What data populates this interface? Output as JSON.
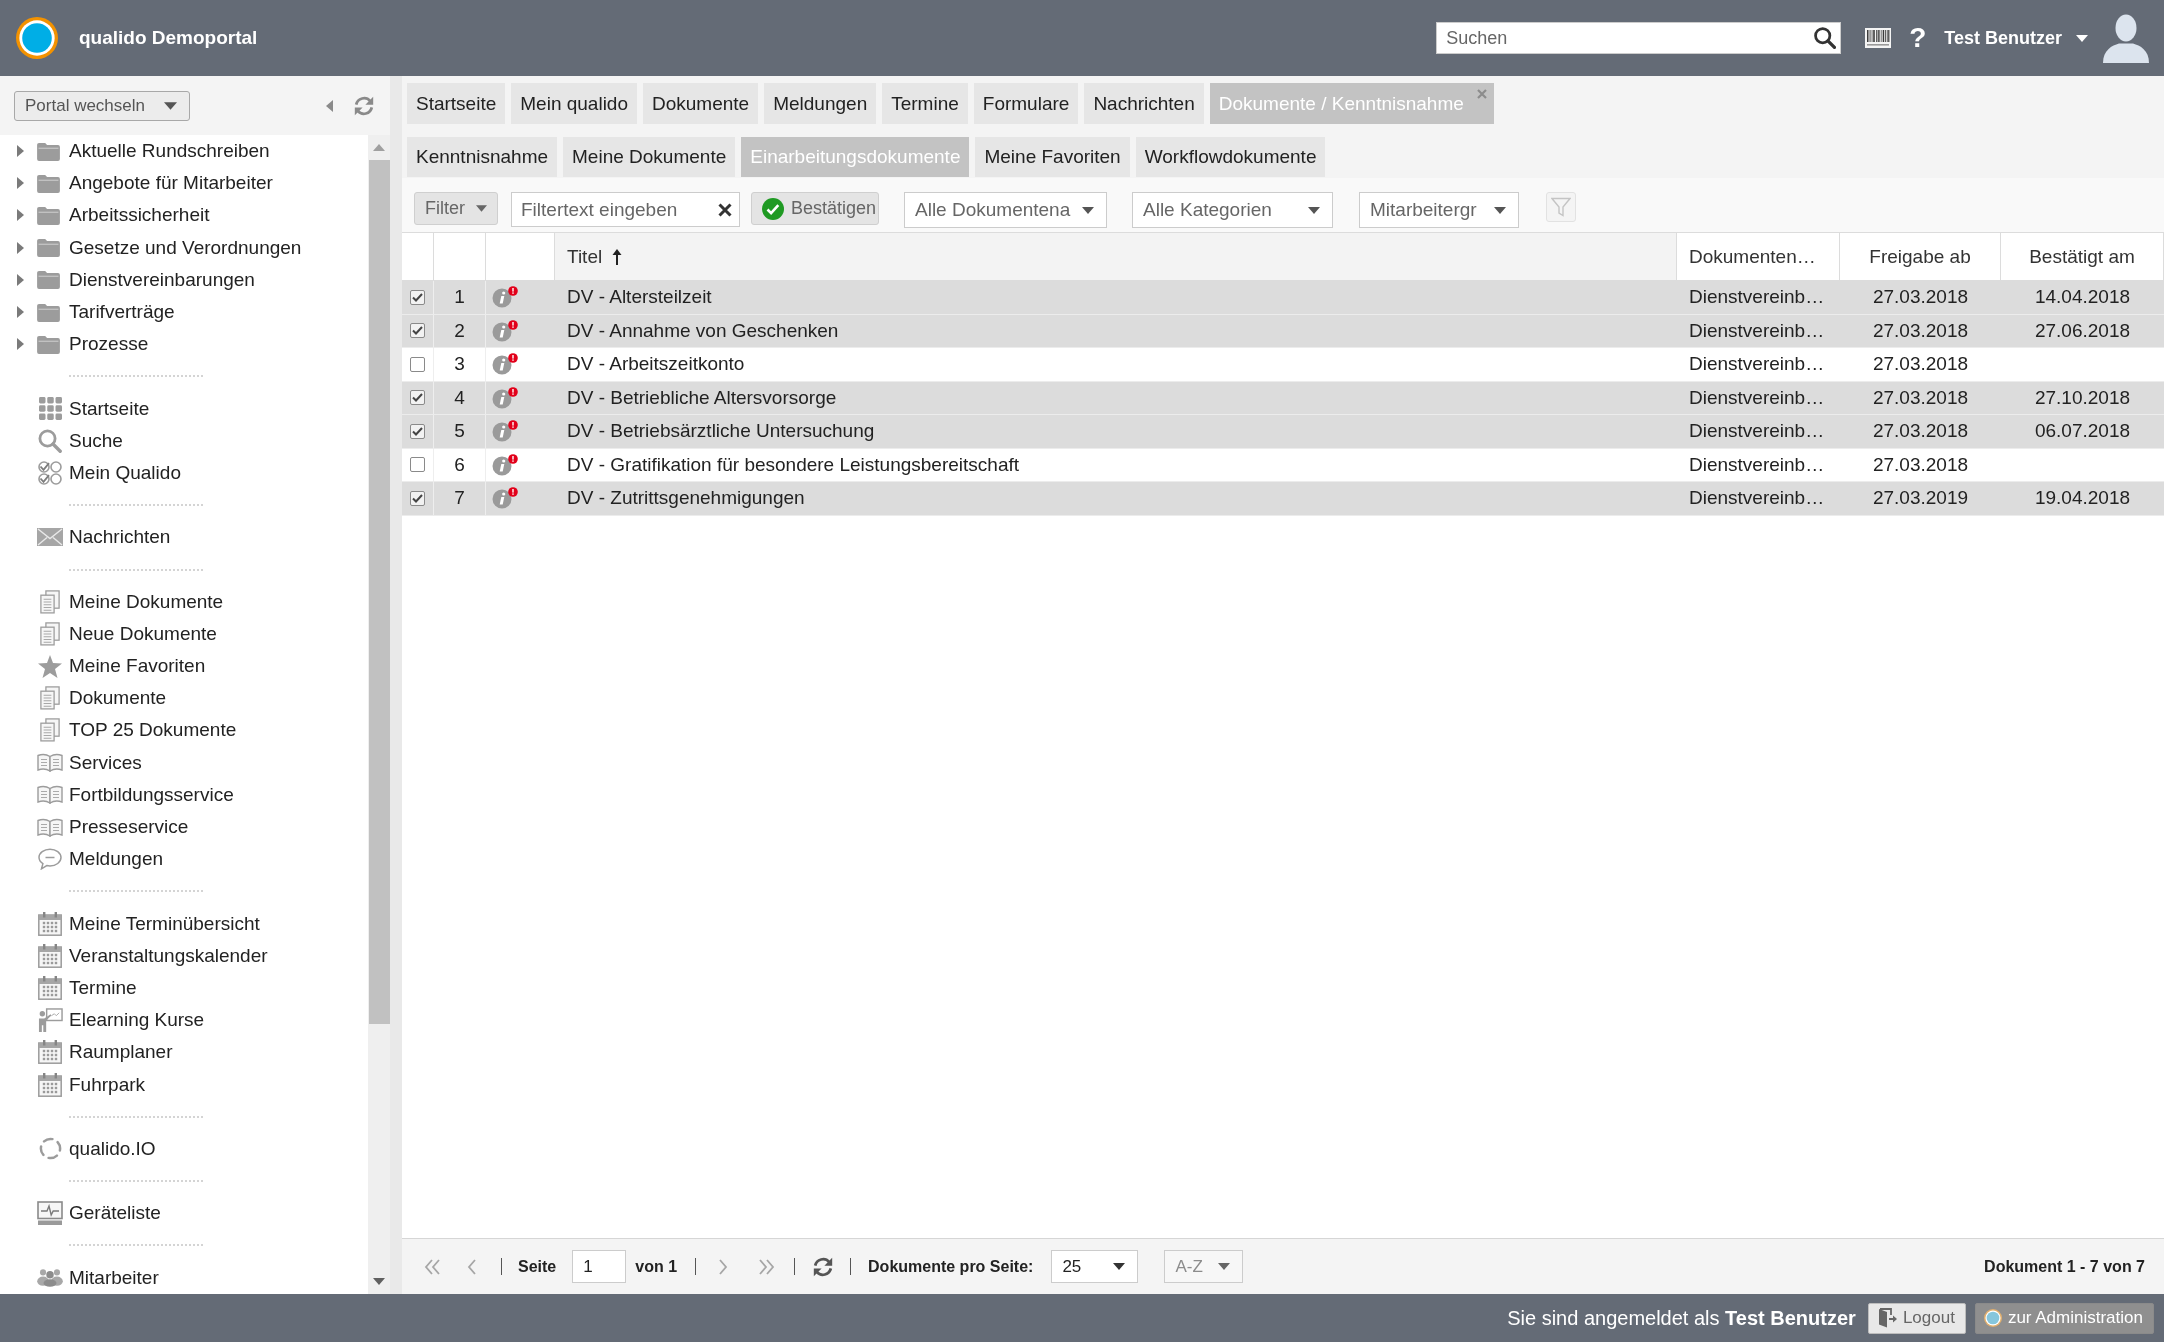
{
  "header": {
    "title": "qualido Demoportal",
    "search": {
      "placeholder": "Suchen"
    },
    "help": "?",
    "user": "Test Benutzer"
  },
  "sidebar": {
    "portal_switch": "Portal wechseln",
    "folders": [
      {
        "label": "Aktuelle Rundschreiben",
        "expanded": false
      },
      {
        "label": "Angebote für Mitarbeiter",
        "expanded": false
      },
      {
        "label": "Arbeitssicherheit",
        "expanded": false
      },
      {
        "label": "Gesetze und Verordnungen",
        "expanded": false
      },
      {
        "label": "Dienstvereinbarungen",
        "expanded": false
      },
      {
        "label": "Tarifverträge",
        "expanded": false
      },
      {
        "label": "Prozesse",
        "expanded": false
      }
    ],
    "groups": [
      {
        "items": [
          {
            "label": "Startseite",
            "kind": "tiles"
          },
          {
            "label": "Suche",
            "kind": "search"
          },
          {
            "label": "Mein Qualido",
            "kind": "checks"
          }
        ]
      },
      {
        "items": [
          {
            "label": "Nachrichten",
            "kind": "mail"
          }
        ]
      },
      {
        "items": [
          {
            "label": "Meine Dokumente",
            "kind": "pages"
          },
          {
            "label": "Neue Dokumente",
            "kind": "pages"
          },
          {
            "label": "Meine Favoriten",
            "kind": "star"
          },
          {
            "label": "Dokumente",
            "kind": "pages"
          },
          {
            "label": "TOP 25 Dokumente",
            "kind": "pages"
          },
          {
            "label": "Services",
            "kind": "book"
          },
          {
            "label": "Fortbildungsservice",
            "kind": "book"
          },
          {
            "label": "Presseservice",
            "kind": "book"
          },
          {
            "label": "Meldungen",
            "kind": "chat"
          }
        ]
      },
      {
        "items": [
          {
            "label": "Meine Terminübersicht",
            "kind": "calendar"
          },
          {
            "label": "Veranstaltungskalender",
            "kind": "calendar"
          },
          {
            "label": "Termine",
            "kind": "calendar"
          },
          {
            "label": "Elearning Kurse",
            "kind": "teacher"
          },
          {
            "label": "Raumplaner",
            "kind": "calendar"
          },
          {
            "label": "Fuhrpark",
            "kind": "calendar"
          }
        ]
      },
      {
        "items": [
          {
            "label": "qualido.IO",
            "kind": "cycle"
          }
        ]
      },
      {
        "items": [
          {
            "label": "Geräteliste",
            "kind": "monitor"
          }
        ]
      },
      {
        "items": [
          {
            "label": "Mitarbeiter",
            "kind": "people"
          }
        ]
      }
    ]
  },
  "tabs": [
    {
      "label": "Startseite",
      "selected": false,
      "closable": false
    },
    {
      "label": "Mein qualido",
      "selected": false,
      "closable": false
    },
    {
      "label": "Dokumente",
      "selected": false,
      "closable": false
    },
    {
      "label": "Meldungen",
      "selected": false,
      "closable": false
    },
    {
      "label": "Termine",
      "selected": false,
      "closable": false
    },
    {
      "label": "Formulare",
      "selected": false,
      "closable": false
    },
    {
      "label": "Nachrichten",
      "selected": false,
      "closable": false
    },
    {
      "label": "Dokumente / Kenntnisnahme",
      "selected": true,
      "closable": true
    }
  ],
  "subtabs": [
    {
      "label": "Kenntnisnahme",
      "selected": false
    },
    {
      "label": "Meine Dokumente",
      "selected": false
    },
    {
      "label": "Einarbeitungsdokumente",
      "selected": true
    },
    {
      "label": "Meine Favoriten",
      "selected": false
    },
    {
      "label": "Workflowdokumente",
      "selected": false
    }
  ],
  "filter_bar": {
    "filter_button": "Filter",
    "filter_text": {
      "placeholder": "Filtertext eingeben"
    },
    "confirm_button": "Bestätigen",
    "dropdowns": [
      "Alle Dokumentena",
      "Alle Kategorien",
      "Mitarbeitergr"
    ],
    "funnel_button": {
      "disabled": true
    }
  },
  "table": {
    "columns": [
      {
        "label": "Titel",
        "sorted": true
      },
      {
        "label": "Dokumenten…",
        "sorted": false
      },
      {
        "label": "Freigabe ab",
        "sorted": false
      },
      {
        "label": "Bestätigt am",
        "sorted": false
      }
    ],
    "rows": [
      {
        "checked": true,
        "number": "1",
        "cells": [
          "DV - Altersteilzeit",
          "Dienstvereinb…",
          "27.03.2018",
          "14.04.2018"
        ]
      },
      {
        "checked": true,
        "number": "2",
        "cells": [
          "DV - Annahme von Geschenken",
          "Dienstvereinb…",
          "27.03.2018",
          "27.06.2018"
        ]
      },
      {
        "checked": false,
        "number": "3",
        "cells": [
          "DV - Arbeitszeitkonto",
          "Dienstvereinb…",
          "27.03.2018"
        ]
      },
      {
        "checked": true,
        "number": "4",
        "cells": [
          "DV - Betriebliche Altersvorsorge",
          "Dienstvereinb…",
          "27.03.2018",
          "27.10.2018"
        ]
      },
      {
        "checked": true,
        "number": "5",
        "cells": [
          "DV - Betriebsärztliche Untersuchung",
          "Dienstvereinb…",
          "27.03.2018",
          "06.07.2018"
        ]
      },
      {
        "checked": false,
        "number": "6",
        "cells": [
          "DV - Gratifikation für besondere Leistungsbereitschaft",
          "Dienstvereinb…",
          "27.03.2018"
        ]
      },
      {
        "checked": true,
        "number": "7",
        "cells": [
          "DV - Zutrittsgenehmigungen",
          "Dienstvereinb…",
          "27.03.2019",
          "19.04.2018"
        ]
      }
    ]
  },
  "pagination": {
    "page_label": "Seite",
    "page": "1",
    "of": "von 1",
    "per_page_label": "Dokumente pro Seite:",
    "per_page": "25",
    "sort_select": {
      "value": "A-Z",
      "disabled": true
    },
    "summary": "Dokument 1 - 7 von 7"
  },
  "footer": {
    "login_text": "Sie sind angemeldet als **Test Benutzer**",
    "logout_button": "Logout",
    "admin_button": {
      "label": "zur Administration",
      "disabled": true
    }
  }
}
